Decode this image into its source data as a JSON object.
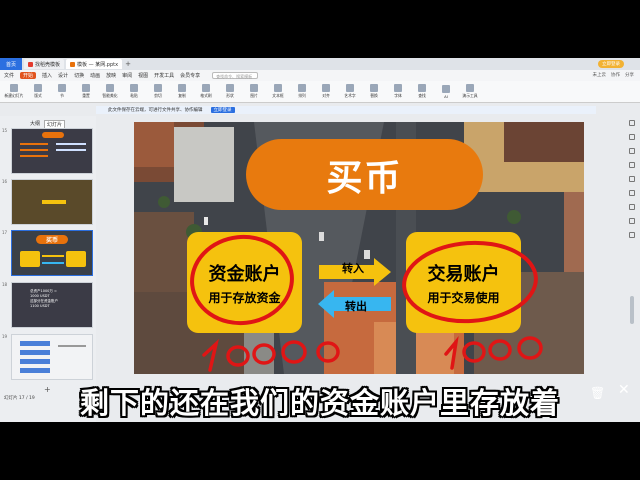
{
  "window": {
    "home_tab": "首页",
    "tabs": [
      {
        "label": "找稻壳模板",
        "color": "#e33b2f"
      },
      {
        "label": "模板 — 某网.pptx",
        "color": "#e8720c"
      }
    ],
    "login_label": "立即登录"
  },
  "menu": {
    "items": [
      "文件",
      "开始",
      "插入",
      "设计",
      "切换",
      "动画",
      "放映",
      "审阅",
      "视图",
      "开发工具",
      "会员专享"
    ],
    "active_index": 1,
    "search_placeholder": "查找命令、搜索模板",
    "right_items": [
      "未上云",
      "协作",
      "分享"
    ]
  },
  "ribbon": {
    "buttons": [
      "新建幻灯片",
      "版式",
      "节",
      "重置",
      "智能美化",
      "粘贴",
      "剪切",
      "复制",
      "格式刷",
      "形状",
      "图片",
      "文本框",
      "排列",
      "对齐",
      "艺术字",
      "替换",
      "字体",
      "查找",
      "AI",
      "演示工具"
    ]
  },
  "notice": {
    "text": "此文件保存在云端，可进行文件共享、协作编辑",
    "button": "立即登录"
  },
  "panel": {
    "tabs": [
      "大纲",
      "幻灯片"
    ],
    "active_tab": 1,
    "slide_numbers": [
      "15",
      "16",
      "17",
      "18",
      "19"
    ],
    "thumb3_title": "买币",
    "thumb4_lines": [
      "总资产1000万 =",
      "1000 USDT",
      "这部分在资金账户",
      "1100 USDT"
    ],
    "add_label": "+",
    "status": "幻灯片 17 / 19"
  },
  "slide": {
    "title": "买币",
    "left_account": {
      "name": "资金账户",
      "desc": "用于存放资金"
    },
    "right_account": {
      "name": "交易账户",
      "desc": "用于交易使用"
    },
    "arrow_in": "转入",
    "arrow_out": "转出",
    "handwriting_left": "10000",
    "handwriting_right": "1000",
    "colors": {
      "title_pill": "#e87a0e",
      "account_box": "#f5c20e",
      "arrow_in": "#f5c20e",
      "arrow_out": "#37b6f0",
      "annotation": "#e01515"
    }
  },
  "subtitle": "剩下的还在我们的资金账户里存放着"
}
